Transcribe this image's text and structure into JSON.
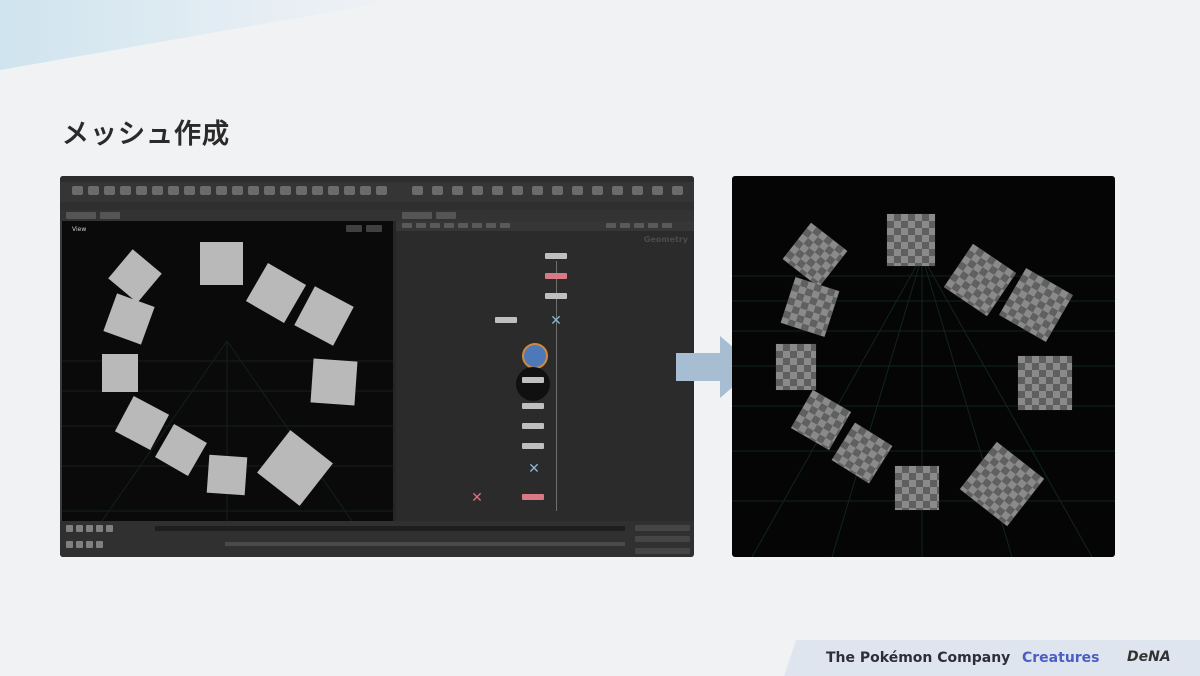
{
  "slide": {
    "title": "メッシュ作成"
  },
  "houdini": {
    "viewport_label": "View",
    "network_label": "Geometry"
  },
  "footer": {
    "company": "The Pokémon Company",
    "creatures": "Creatures",
    "dena": "DeNA"
  },
  "icons": [
    "arrow-right-icon",
    "color-palette-icon"
  ],
  "colors": {
    "background": "#f1f2f4",
    "accent_blue": "#4a5fc4",
    "arrow": "#a6bdd2",
    "viewport": "#0a0a0a"
  }
}
